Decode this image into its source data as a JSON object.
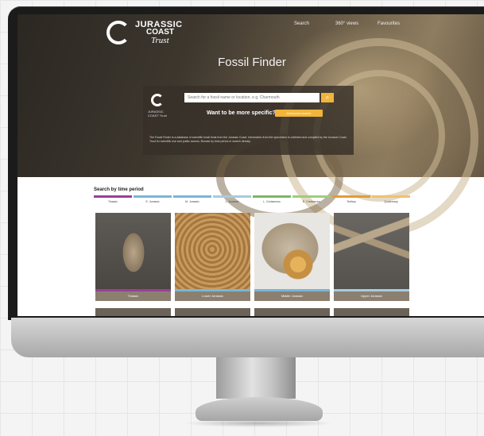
{
  "site": {
    "logo": {
      "line1": "JURASSIC",
      "line2": "COAST",
      "line3": "Trust"
    },
    "nav": [
      "Search",
      "360° views",
      "Favourites"
    ],
    "title": "Fossil Finder",
    "search": {
      "placeholder": "Search for a fossil name or location, e.g. Charmouth",
      "button_icon": "search-icon",
      "specific_question": "Want to be more specific?",
      "specific_button": "Advanced search"
    },
    "panel_logo_text": "JURASSIC COAST Trust",
    "panel_text": "The Fossil Finder is a database of scientific fossil finds from the Jurassic Coast. Information from the specimens is collected and compiled by the Jurassic Coast Trust for scientific use and public access. Browse by time period or search directly.",
    "section_title": "Search by time period",
    "tabs": [
      {
        "label": "Triassic",
        "color": "#9a3f95"
      },
      {
        "label": "E. Jurassic",
        "color": "#79b6d8"
      },
      {
        "label": "M. Jurassic",
        "color": "#79b6d8"
      },
      {
        "label": "L. Jurassic",
        "color": "#a6cbe0"
      },
      {
        "label": "L. Cretaceous",
        "color": "#7ab864"
      },
      {
        "label": "E. Cretaceous",
        "color": "#9fcd7a"
      },
      {
        "label": "Tertiary",
        "color": "#e59a36"
      },
      {
        "label": "Quaternary",
        "color": "#f1c070"
      }
    ],
    "cards": [
      {
        "caption": "Triassic",
        "bar_color": "#9a3f95"
      },
      {
        "caption": "Lower Jurassic",
        "bar_color": "#79b6d8"
      },
      {
        "caption": "Middle Jurassic",
        "bar_color": "#79b6d8"
      },
      {
        "caption": "Upper Jurassic",
        "bar_color": "#a6cbe0"
      }
    ]
  }
}
